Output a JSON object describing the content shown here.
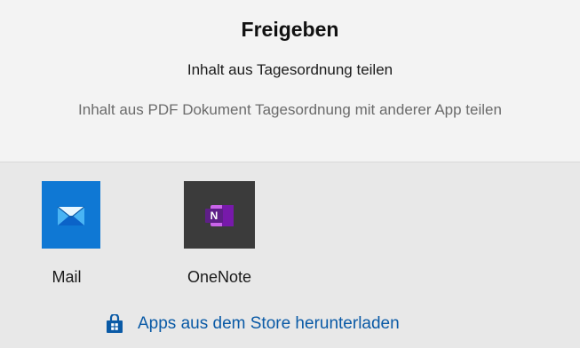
{
  "dialog": {
    "title": "Freigeben",
    "subtitle": "Inhalt aus Tagesordnung teilen",
    "description": "Inhalt aus PDF Dokument Tagesordnung mit anderer App teilen"
  },
  "apps": [
    {
      "label": "Mail",
      "icon": "mail-icon",
      "color": "#0f78d4"
    },
    {
      "label": "OneNote",
      "icon": "onenote-icon",
      "color": "#7719aa"
    }
  ],
  "store": {
    "label": "Apps aus dem Store herunterladen",
    "icon": "store-bag-icon",
    "color": "#0a5aa6"
  }
}
